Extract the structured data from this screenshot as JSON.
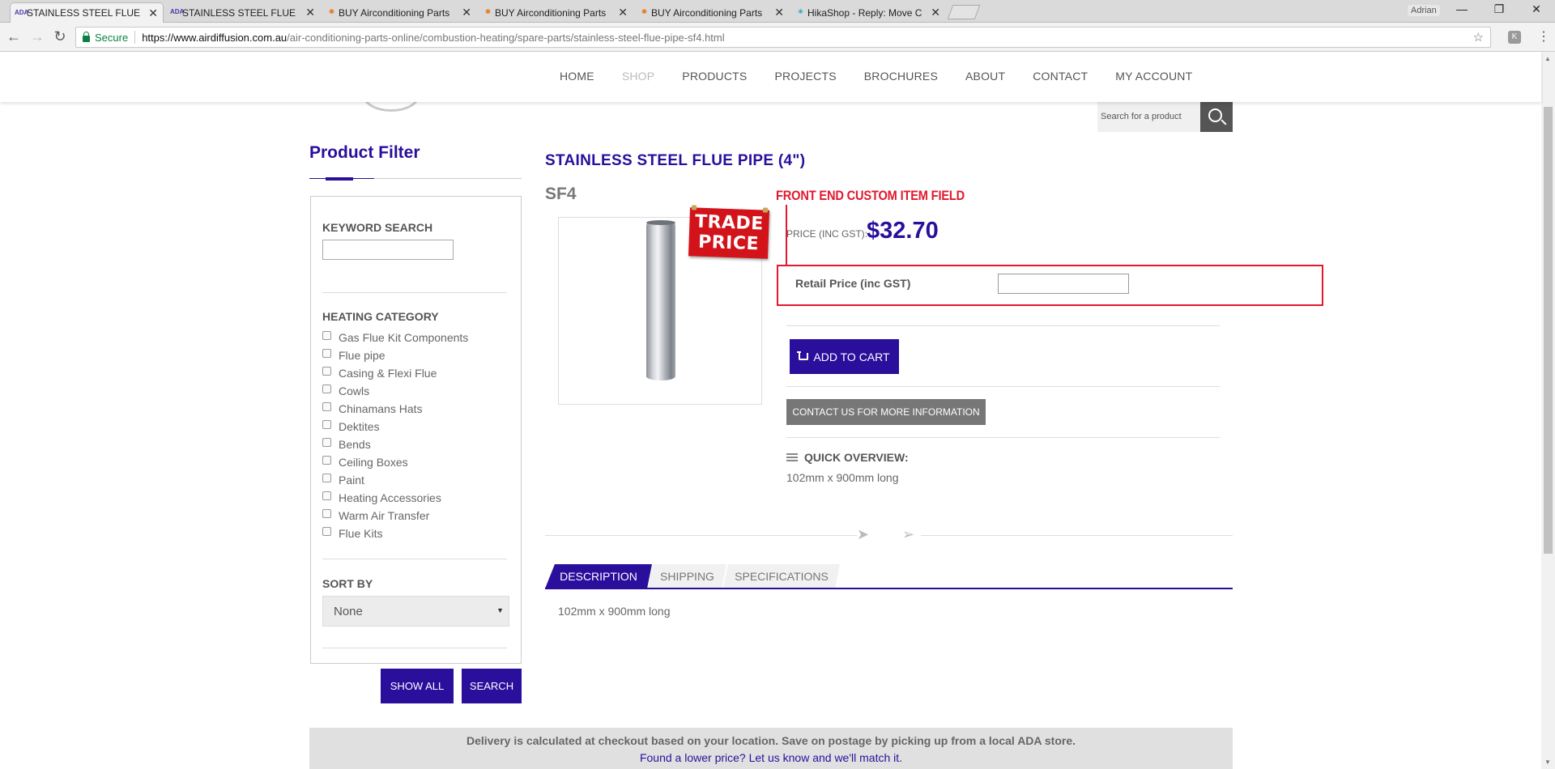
{
  "browser": {
    "tabs": [
      {
        "title": "STAINLESS STEEL FLUE PI",
        "favicon": "ada-logo-icon",
        "active": true
      },
      {
        "title": "STAINLESS STEEL FLUE PI",
        "favicon": "ada-logo-icon",
        "active": false
      },
      {
        "title": "BUY Airconditioning Parts",
        "favicon": "joomla-icon",
        "active": false
      },
      {
        "title": "BUY Airconditioning Parts",
        "favicon": "joomla-icon",
        "active": false
      },
      {
        "title": "BUY Airconditioning Parts",
        "favicon": "joomla-icon",
        "active": false
      },
      {
        "title": "HikaShop - Reply: Move C",
        "favicon": "hikashop-icon",
        "active": false
      }
    ],
    "user": "Adrian",
    "secure_label": "Secure",
    "url_host": "https://www.airdiffusion.com.au",
    "url_path": "/air-conditioning-parts-online/combustion-heating/spare-parts/stainless-steel-flue-pipe-sf4.html",
    "ext_label": "K"
  },
  "nav": {
    "items": [
      "HOME",
      "SHOP",
      "PRODUCTS",
      "PROJECTS",
      "BROCHURES",
      "ABOUT",
      "CONTACT",
      "MY ACCOUNT"
    ]
  },
  "search": {
    "placeholder": "Search for a product"
  },
  "sidebar": {
    "title": "Product Filter",
    "keyword_label": "KEYWORD SEARCH",
    "category_label": "HEATING CATEGORY",
    "categories": [
      "Gas Flue Kit Components",
      "Flue pipe",
      "Casing & Flexi Flue",
      "Cowls",
      "Chinamans Hats",
      "Dektites",
      "Bends",
      "Ceiling Boxes",
      "Paint",
      "Heating Accessories",
      "Warm Air Transfer",
      "Flue Kits"
    ],
    "sort_label": "SORT BY",
    "sort_value": "None",
    "show_all": "SHOW ALL",
    "search_btn": "SEARCH"
  },
  "product": {
    "title": "STAINLESS STEEL FLUE PIPE (4\")",
    "code": "SF4",
    "badge_line1": "TRADE",
    "badge_line2": "PRICE",
    "annotation": "FRONT END CUSTOM ITEM FIELD",
    "price_label": "PRICE (INC GST):",
    "price": "$32.70",
    "retail_label": "Retail Price (inc GST)",
    "add_to_cart": "ADD TO CART",
    "contact": "CONTACT US FOR MORE INFORMATION",
    "overview_title": "QUICK OVERVIEW:",
    "overview_text": "102mm x 900mm long"
  },
  "tabs": {
    "items": [
      "DESCRIPTION",
      "SHIPPING",
      "SPECIFICATIONS"
    ],
    "description": "102mm x 900mm long"
  },
  "footer": {
    "delivery": "Delivery is calculated at checkout based on your location. Save on postage by picking up from a local ADA store.",
    "lower_price": "Found a lower price? Let us know and we'll match it."
  },
  "colors": {
    "brand_purple": "#2a0e9c",
    "annotation_red": "#e2182d",
    "trade_red": "#d2131a"
  }
}
